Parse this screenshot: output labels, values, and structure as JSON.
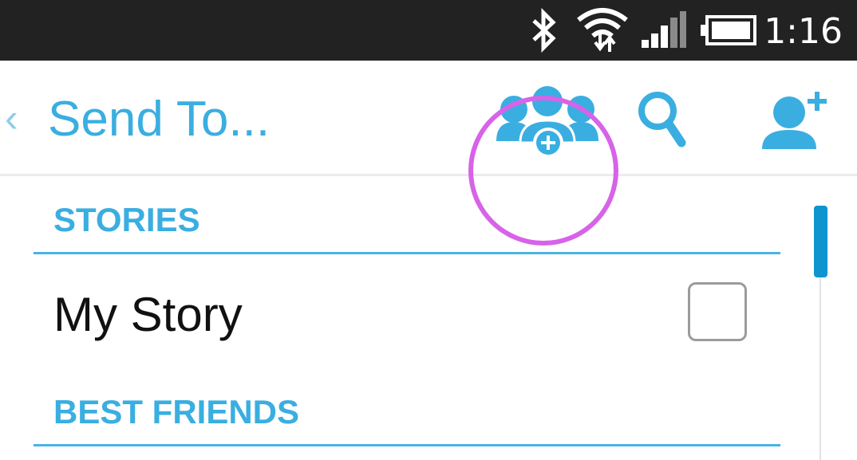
{
  "status_bar": {
    "time": "1:16",
    "icons": [
      "bluetooth-icon",
      "wifi-icon",
      "signal-icon",
      "battery-icon"
    ]
  },
  "action_bar": {
    "back_glyph": "‹",
    "title": "Send To...",
    "actions": [
      "add-group-icon",
      "search-icon",
      "add-friend-icon"
    ],
    "highlight_color": "#d763e8"
  },
  "sections": [
    {
      "header": "STORIES",
      "items": [
        {
          "label": "My Story",
          "checked": false
        }
      ]
    },
    {
      "header": "BEST FRIENDS",
      "items": []
    }
  ],
  "colors": {
    "accent": "#3aaee0",
    "status_bar": "#222222",
    "scroll_thumb": "#0e95cf"
  }
}
